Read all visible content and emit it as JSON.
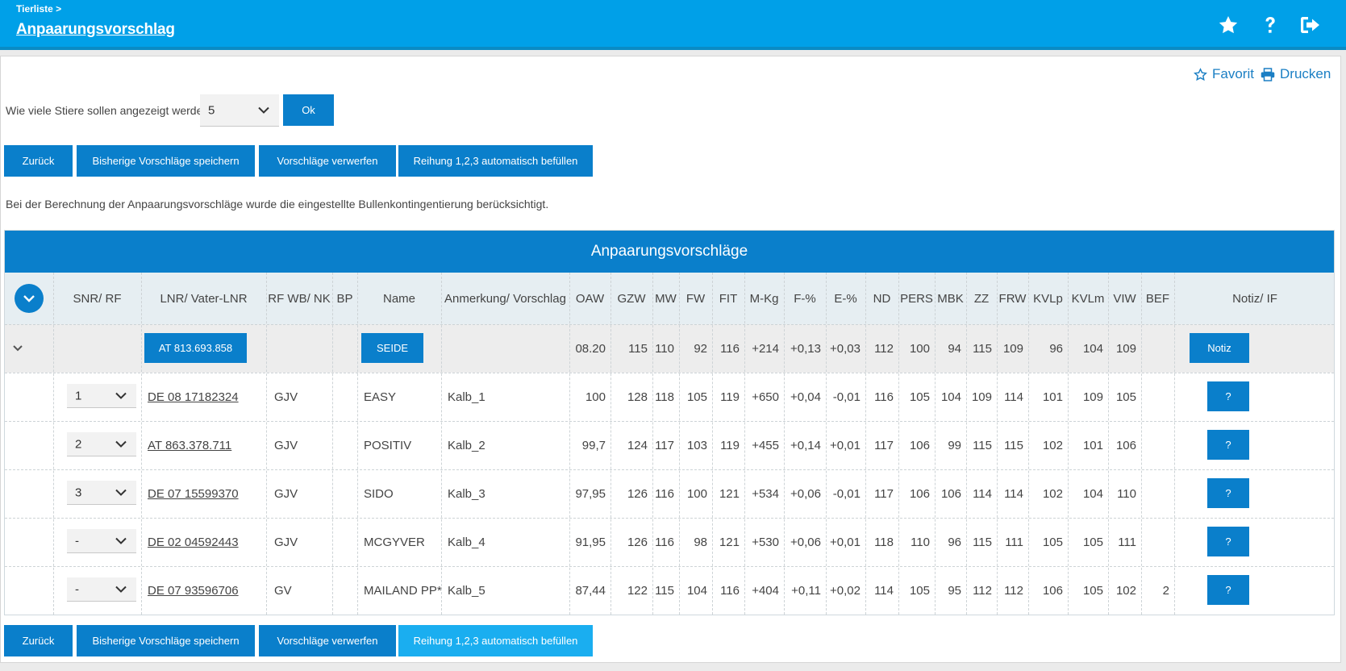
{
  "header": {
    "breadcrumb": "Tierliste >",
    "title": "Anpaarungsvorschlag",
    "icons": [
      "star-icon",
      "help-icon",
      "logout-icon"
    ]
  },
  "actions": {
    "favorite": "Favorit",
    "print": "Drucken"
  },
  "count": {
    "label": "Wie viele Stiere sollen angezeigt werden",
    "value": "5",
    "ok": "Ok"
  },
  "buttons": {
    "back": "Zurück",
    "save": "Bisherige Vorschläge speichern",
    "discard": "Vorschläge verwerfen",
    "autofill": "Reihung 1,2,3 automatisch befüllen"
  },
  "info": "Bei der Berechnung der Anpaarungsvorschläge wurde die eingestellte Bullenkontingentierung berücksichtigt.",
  "table": {
    "title": "Anpaarungsvorschläge",
    "headers": [
      "SNR/ RF",
      "LNR/ Vater-LNR",
      "RF WB/ NK",
      "BP",
      "Name",
      "Anmerkung/ Vorschlag",
      "OAW",
      "GZW",
      "MW",
      "FW",
      "FIT",
      "M-Kg",
      "F-%",
      "E-%",
      "ND",
      "PERS",
      "MBK",
      "ZZ",
      "FRW",
      "KVLp",
      "KVLm",
      "VIW",
      "BEF",
      "Notiz/ IF"
    ],
    "cow": {
      "lnr": "AT 813.693.858",
      "name": "SEIDE",
      "values": [
        "08.20",
        "115",
        "110",
        "92",
        "116",
        "+214",
        "+0,13",
        "+0,03",
        "112",
        "100",
        "94",
        "115",
        "109",
        "96",
        "104",
        "109",
        ""
      ],
      "note_button": "Notiz"
    },
    "rows": [
      {
        "snr": "1",
        "lnr": "DE 08 17182324",
        "rf": "GJV",
        "bp": "",
        "name": "EASY",
        "note": "Kalb_1",
        "values": [
          "100",
          "128",
          "118",
          "105",
          "119",
          "+650",
          "+0,04",
          "-0,01",
          "116",
          "105",
          "104",
          "109",
          "114",
          "101",
          "109",
          "105",
          ""
        ],
        "if_button": "?"
      },
      {
        "snr": "2",
        "lnr": "AT 863.378.711",
        "rf": "GJV",
        "bp": "",
        "name": "POSITIV",
        "note": "Kalb_2",
        "values": [
          "99,7",
          "124",
          "117",
          "103",
          "119",
          "+455",
          "+0,14",
          "+0,01",
          "117",
          "106",
          "99",
          "115",
          "115",
          "102",
          "101",
          "106",
          ""
        ],
        "if_button": "?"
      },
      {
        "snr": "3",
        "lnr": "DE 07 15599370",
        "rf": "GJV",
        "bp": "",
        "name": "SIDO",
        "note": "Kalb_3",
        "values": [
          "97,95",
          "126",
          "116",
          "100",
          "121",
          "+534",
          "+0,06",
          "-0,01",
          "117",
          "106",
          "106",
          "114",
          "114",
          "102",
          "104",
          "110",
          ""
        ],
        "if_button": "?"
      },
      {
        "snr": "-",
        "lnr": "DE 02 04592443",
        "rf": "GJV",
        "bp": "",
        "name": "MCGYVER",
        "note": "Kalb_4",
        "values": [
          "91,95",
          "126",
          "116",
          "98",
          "121",
          "+530",
          "+0,06",
          "+0,01",
          "118",
          "110",
          "96",
          "115",
          "111",
          "105",
          "105",
          "111",
          ""
        ],
        "if_button": "?"
      },
      {
        "snr": "-",
        "lnr": "DE 07 93596706",
        "rf": "GV",
        "bp": "",
        "name": "MAILAND PP*",
        "note": "Kalb_5",
        "values": [
          "87,44",
          "122",
          "115",
          "104",
          "116",
          "+404",
          "+0,11",
          "+0,02",
          "114",
          "105",
          "95",
          "112",
          "112",
          "106",
          "105",
          "102",
          "2"
        ],
        "if_button": "?"
      }
    ]
  },
  "colors": {
    "header": "#00a0e8",
    "primary": "#0a7fcb",
    "primary_light": "#1aaef0"
  }
}
